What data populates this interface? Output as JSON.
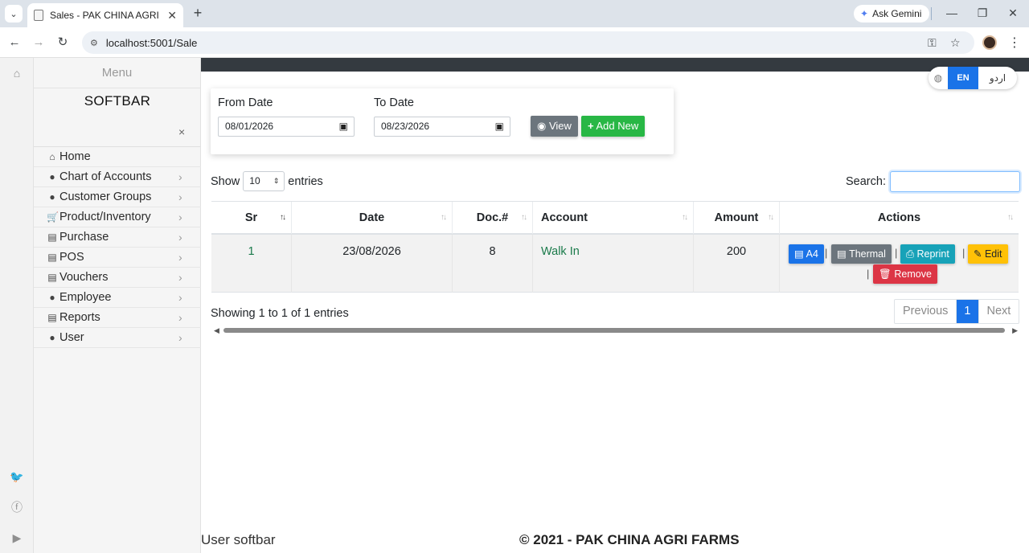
{
  "browser": {
    "tab_title": "Sales - PAK CHINA AGRI FARMS",
    "tab_close": "✕",
    "new_tab": "+",
    "ask_gemini": "Ask Gemini",
    "url": "localhost:5001/Sale"
  },
  "sidebar": {
    "menu_heading": "Menu",
    "brand": "SOFTBAR",
    "close": "×",
    "items": [
      {
        "label": "Home",
        "icon": "home-icon",
        "has_submenu": false
      },
      {
        "label": "Chart of Accounts",
        "icon": "user-icon",
        "has_submenu": true
      },
      {
        "label": "Customer Groups",
        "icon": "users-icon",
        "has_submenu": true
      },
      {
        "label": "Product/Inventory",
        "icon": "cart-icon",
        "has_submenu": true
      },
      {
        "label": "Purchase",
        "icon": "file-icon",
        "has_submenu": true
      },
      {
        "label": "POS",
        "icon": "file-icon",
        "has_submenu": true
      },
      {
        "label": "Vouchers",
        "icon": "file-icon",
        "has_submenu": true
      },
      {
        "label": "Employee",
        "icon": "user-icon",
        "has_submenu": true
      },
      {
        "label": "Reports",
        "icon": "file-icon",
        "has_submenu": true
      },
      {
        "label": "User",
        "icon": "user-icon",
        "has_submenu": true
      }
    ]
  },
  "lang": {
    "en": "EN",
    "ur": "اردو"
  },
  "filters": {
    "from_label": "From Date",
    "from_value": "08/01/2026",
    "to_label": "To Date",
    "to_value": "08/23/2026",
    "view_label": "View",
    "add_label": "Add New"
  },
  "list": {
    "show_label": "Show",
    "page_size": "10",
    "entries_label": "entries",
    "search_label": "Search:",
    "search_value": ""
  },
  "table": {
    "headers": [
      "Sr",
      "Date",
      "Doc.#",
      "Account",
      "Amount",
      "Actions"
    ],
    "rows": [
      {
        "sr": "1",
        "date": "23/08/2026",
        "doc": "8",
        "account": "Walk In",
        "amount": "200"
      }
    ],
    "actions": {
      "a4": "A4",
      "thermal": "Thermal",
      "reprint": "Reprint",
      "edit": "Edit",
      "remove": "Remove"
    }
  },
  "pagination": {
    "summary": "Showing 1 to 1 of 1 entries",
    "previous": "Previous",
    "current": "1",
    "next": "Next"
  },
  "footer": {
    "user": "User softbar",
    "copyright": "© 2021 - PAK CHINA AGRI FARMS"
  },
  "colors": {
    "primary": "#1a73e8",
    "secondary": "#6c757d",
    "success": "#28b745",
    "info": "#17a2b8",
    "warning": "#ffc107",
    "danger": "#dc3545",
    "dark_strip": "#343a40"
  }
}
